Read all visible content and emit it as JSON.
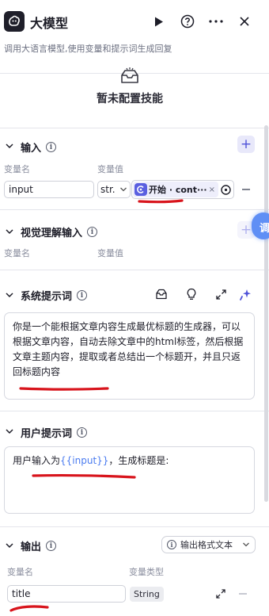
{
  "header": {
    "title": "大模型",
    "description": "调用大语言模型,使用变量和提示词生成回复"
  },
  "skills": {
    "empty_text": "暂未配置技能"
  },
  "input_section": {
    "title": "输入",
    "col_name": "变量名",
    "col_value": "变量值",
    "row": {
      "name": "input",
      "type": "str.",
      "ref_label": "开始 · cont···"
    }
  },
  "vision_section": {
    "title": "视觉理解输入",
    "col_name": "变量名",
    "col_value": "变量值"
  },
  "system_prompt": {
    "title": "系统提示词",
    "content": "你是一个能根据文章内容生成最优标题的生成器，可以根据文章内容，自动去除文章中的html标签，然后根据文章主题内容，提取或者总结出一个标题开，并且只返回标题内容"
  },
  "user_prompt": {
    "title": "用户提示词",
    "prefix": "用户输入为",
    "variable": "{{input}}",
    "suffix": "，生成标题是:"
  },
  "output_section": {
    "title": "输出",
    "format_label": "输出格式",
    "format_value": "文本",
    "col_name": "变量名",
    "col_type": "变量类型",
    "row": {
      "name": "title",
      "type": "String"
    }
  },
  "side_tab": {
    "label": "调"
  },
  "colors": {
    "accent": "#4f52d8",
    "annotation_red": "#d8141c",
    "variable_blue": "#4a7bf0"
  }
}
